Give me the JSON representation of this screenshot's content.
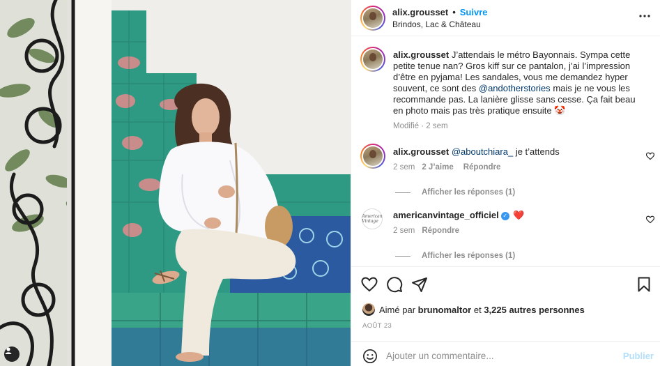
{
  "post_header": {
    "username": "alix.grousset",
    "separator": "•",
    "follow_label": "Suivre",
    "location": "Brindos, Lac & Château"
  },
  "caption": {
    "username": "alix.grousset",
    "text_before_mention": "J’attendais le métro Bayonnais. Sympa cette petite tenue nan? Gros kiff sur ce pantalon, j’ai l’impression d’être en pyjama! Les sandales, vous me demandez hyper souvent, ce sont des",
    "mention": "@andotherstories",
    "text_after_mention": "mais je ne vous les recommande pas. La lanière glisse sans cesse. Ça fait beau en photo mais pas très pratique ensuite",
    "emoji": "🤡",
    "meta": "Modifié · 2 sem"
  },
  "comments": [
    {
      "username": "alix.grousset",
      "mention": "@aboutchiara_",
      "text": "je t’attends",
      "time": "2 sem",
      "likes": "2 J’aime",
      "reply_label": "Répondre",
      "view_replies": "Afficher les réponses (1)"
    },
    {
      "username": "americanvintage_officiel",
      "verified_mark": "✓",
      "text": "❤️",
      "avatar_text": "American Vintage",
      "time": "2 sem",
      "reply_label": "Répondre",
      "view_replies": "Afficher les réponses (1)"
    }
  ],
  "likes": {
    "prefix": "Aimé par",
    "first_user": "brunomaltor",
    "connector": "et",
    "others": "3,225 autres personnes"
  },
  "date": "AOÛT 23",
  "add_comment": {
    "placeholder": "Ajouter un commentaire...",
    "post_label": "Publier"
  },
  "colors": {
    "accent": "#0095f6",
    "text": "#262626",
    "muted": "#8e8e8e",
    "like_red": "#ed4956",
    "post_disabled": "#b2dffc",
    "tile_teal": "#2e9a84",
    "tile_blue": "#2c5aa0"
  },
  "icons": [
    "more-icon",
    "heart-icon",
    "comment-icon",
    "share-icon",
    "save-icon",
    "emoji-icon",
    "user-tag-icon"
  ]
}
